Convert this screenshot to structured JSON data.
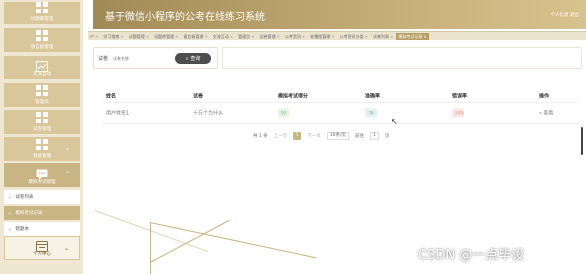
{
  "header": {
    "title": "基于微信小程序的公考在线练习系统",
    "user_area": "个人信息  退出"
  },
  "sidebar": {
    "items": [
      {
        "label": "试题库管理"
      },
      {
        "label": "留言板管理"
      },
      {
        "label": "交流互动"
      },
      {
        "label": "管理员"
      },
      {
        "label": "试卷管理"
      },
      {
        "label": "系统管理"
      },
      {
        "label": "模拟考试管理"
      }
    ],
    "sub_items": [
      {
        "label": "试卷列表"
      },
      {
        "label": "模拟考试记录"
      },
      {
        "label": "错题本"
      }
    ],
    "profile": {
      "label": "个人中心"
    }
  },
  "tabs": [
    "户",
    "学习指南",
    "试题管理",
    "试题库管理",
    "留言板管理",
    "交流互动",
    "管理员",
    "试卷管理",
    "公考资讯",
    "轮播图管理",
    "公考资讯分类",
    "试卷列表",
    "模拟考试记录"
  ],
  "active_tab": "模拟考试记录",
  "search": {
    "label": "试卷",
    "placeholder": "试卷名称",
    "button_label": "查询"
  },
  "table": {
    "headers": [
      "姓名",
      "试卷",
      "模拟考试得分",
      "准确率",
      "错误率",
      "操作"
    ],
    "rows": [
      {
        "name": "用户姓名1",
        "paper": "十万个为什么",
        "score": "90",
        "accuracy": "76",
        "error_rate": "24%",
        "action": "查看"
      }
    ]
  },
  "pager": {
    "total": "共 1 条",
    "prev": "上一页",
    "current_page": "1",
    "next": "下一页",
    "page_size": "10条/页",
    "goto_label": "前往",
    "goto_value": "1",
    "page_unit": "页"
  },
  "watermark": "CSDN @一点毕设",
  "colors": {
    "accent": "#c9b483",
    "header": "#b79f67",
    "sidebar_bg": "#efe7d2"
  }
}
